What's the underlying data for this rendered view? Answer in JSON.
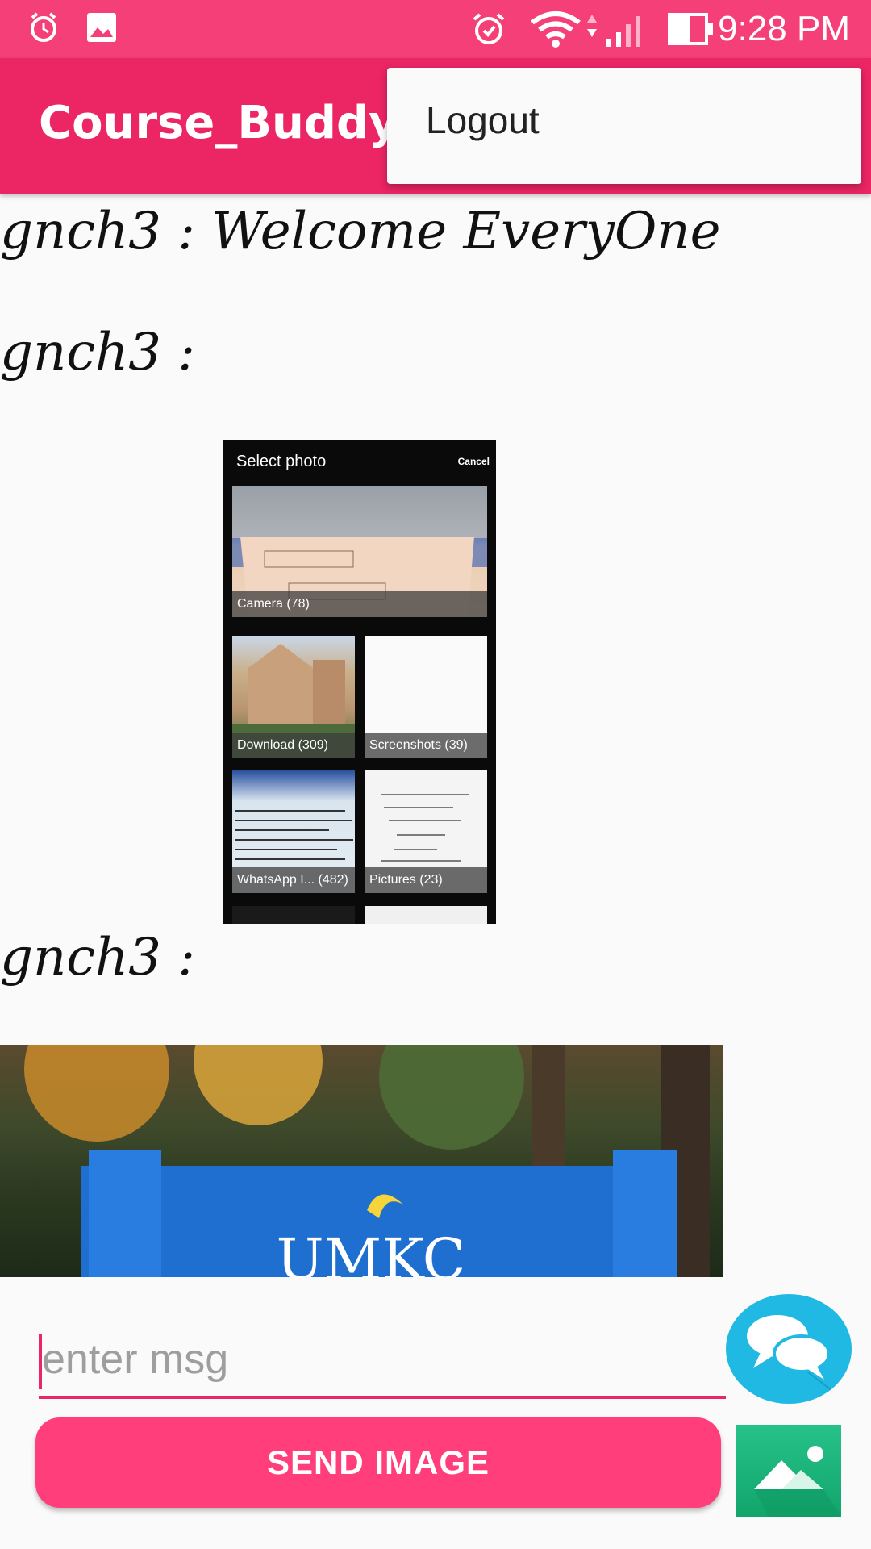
{
  "status_bar": {
    "time": "9:28 PM",
    "icons": [
      "alarm-icon",
      "image-icon",
      "alarm-clock-icon",
      "wifi-icon",
      "signal-icon",
      "battery-icon"
    ]
  },
  "app_bar": {
    "title": "Course_Buddy"
  },
  "overflow_menu": {
    "items": [
      "Logout"
    ]
  },
  "messages": [
    {
      "text": "gnch3 : Welcome EveryOne"
    },
    {
      "text": "gnch3 :"
    },
    {
      "text": "gnch3 :"
    }
  ],
  "photo_picker_screenshot": {
    "title": "Select photo",
    "cancel": "Cancel",
    "albums": [
      {
        "label": "Camera (78)"
      },
      {
        "label": "Download (309)"
      },
      {
        "label": "Screenshots (39)"
      },
      {
        "label": "WhatsApp I... (482)"
      },
      {
        "label": "Pictures (23)"
      }
    ]
  },
  "umkc_photo": {
    "sign_text": "UMKC"
  },
  "input": {
    "placeholder": "enter msg",
    "value": ""
  },
  "buttons": {
    "send_image": "SEND IMAGE"
  },
  "colors": {
    "status_bar": "#f53f78",
    "app_bar": "#ec2565",
    "accent": "#ff3e7b",
    "chat_fab": "#1fb9e4",
    "gallery_button": "#12a56b"
  }
}
